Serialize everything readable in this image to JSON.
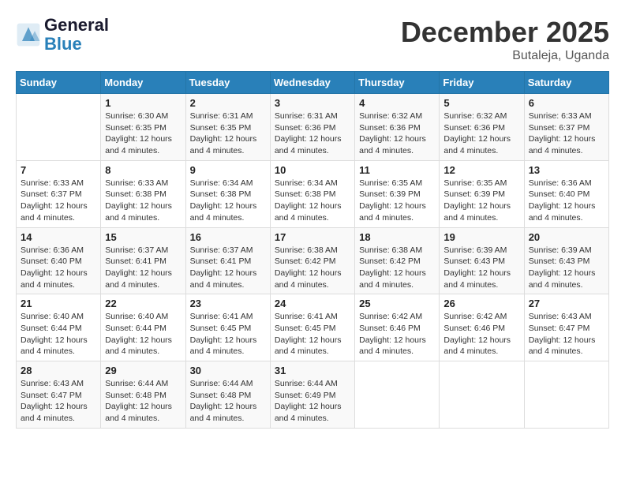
{
  "logo": {
    "line1": "General",
    "line2": "Blue"
  },
  "title": "December 2025",
  "location": "Butaleja, Uganda",
  "days_of_week": [
    "Sunday",
    "Monday",
    "Tuesday",
    "Wednesday",
    "Thursday",
    "Friday",
    "Saturday"
  ],
  "weeks": [
    [
      {
        "num": "",
        "sunrise": "",
        "sunset": "",
        "daylight": ""
      },
      {
        "num": "1",
        "sunrise": "Sunrise: 6:30 AM",
        "sunset": "Sunset: 6:35 PM",
        "daylight": "Daylight: 12 hours and 4 minutes."
      },
      {
        "num": "2",
        "sunrise": "Sunrise: 6:31 AM",
        "sunset": "Sunset: 6:35 PM",
        "daylight": "Daylight: 12 hours and 4 minutes."
      },
      {
        "num": "3",
        "sunrise": "Sunrise: 6:31 AM",
        "sunset": "Sunset: 6:36 PM",
        "daylight": "Daylight: 12 hours and 4 minutes."
      },
      {
        "num": "4",
        "sunrise": "Sunrise: 6:32 AM",
        "sunset": "Sunset: 6:36 PM",
        "daylight": "Daylight: 12 hours and 4 minutes."
      },
      {
        "num": "5",
        "sunrise": "Sunrise: 6:32 AM",
        "sunset": "Sunset: 6:36 PM",
        "daylight": "Daylight: 12 hours and 4 minutes."
      },
      {
        "num": "6",
        "sunrise": "Sunrise: 6:33 AM",
        "sunset": "Sunset: 6:37 PM",
        "daylight": "Daylight: 12 hours and 4 minutes."
      }
    ],
    [
      {
        "num": "7",
        "sunrise": "Sunrise: 6:33 AM",
        "sunset": "Sunset: 6:37 PM",
        "daylight": "Daylight: 12 hours and 4 minutes."
      },
      {
        "num": "8",
        "sunrise": "Sunrise: 6:33 AM",
        "sunset": "Sunset: 6:38 PM",
        "daylight": "Daylight: 12 hours and 4 minutes."
      },
      {
        "num": "9",
        "sunrise": "Sunrise: 6:34 AM",
        "sunset": "Sunset: 6:38 PM",
        "daylight": "Daylight: 12 hours and 4 minutes."
      },
      {
        "num": "10",
        "sunrise": "Sunrise: 6:34 AM",
        "sunset": "Sunset: 6:38 PM",
        "daylight": "Daylight: 12 hours and 4 minutes."
      },
      {
        "num": "11",
        "sunrise": "Sunrise: 6:35 AM",
        "sunset": "Sunset: 6:39 PM",
        "daylight": "Daylight: 12 hours and 4 minutes."
      },
      {
        "num": "12",
        "sunrise": "Sunrise: 6:35 AM",
        "sunset": "Sunset: 6:39 PM",
        "daylight": "Daylight: 12 hours and 4 minutes."
      },
      {
        "num": "13",
        "sunrise": "Sunrise: 6:36 AM",
        "sunset": "Sunset: 6:40 PM",
        "daylight": "Daylight: 12 hours and 4 minutes."
      }
    ],
    [
      {
        "num": "14",
        "sunrise": "Sunrise: 6:36 AM",
        "sunset": "Sunset: 6:40 PM",
        "daylight": "Daylight: 12 hours and 4 minutes."
      },
      {
        "num": "15",
        "sunrise": "Sunrise: 6:37 AM",
        "sunset": "Sunset: 6:41 PM",
        "daylight": "Daylight: 12 hours and 4 minutes."
      },
      {
        "num": "16",
        "sunrise": "Sunrise: 6:37 AM",
        "sunset": "Sunset: 6:41 PM",
        "daylight": "Daylight: 12 hours and 4 minutes."
      },
      {
        "num": "17",
        "sunrise": "Sunrise: 6:38 AM",
        "sunset": "Sunset: 6:42 PM",
        "daylight": "Daylight: 12 hours and 4 minutes."
      },
      {
        "num": "18",
        "sunrise": "Sunrise: 6:38 AM",
        "sunset": "Sunset: 6:42 PM",
        "daylight": "Daylight: 12 hours and 4 minutes."
      },
      {
        "num": "19",
        "sunrise": "Sunrise: 6:39 AM",
        "sunset": "Sunset: 6:43 PM",
        "daylight": "Daylight: 12 hours and 4 minutes."
      },
      {
        "num": "20",
        "sunrise": "Sunrise: 6:39 AM",
        "sunset": "Sunset: 6:43 PM",
        "daylight": "Daylight: 12 hours and 4 minutes."
      }
    ],
    [
      {
        "num": "21",
        "sunrise": "Sunrise: 6:40 AM",
        "sunset": "Sunset: 6:44 PM",
        "daylight": "Daylight: 12 hours and 4 minutes."
      },
      {
        "num": "22",
        "sunrise": "Sunrise: 6:40 AM",
        "sunset": "Sunset: 6:44 PM",
        "daylight": "Daylight: 12 hours and 4 minutes."
      },
      {
        "num": "23",
        "sunrise": "Sunrise: 6:41 AM",
        "sunset": "Sunset: 6:45 PM",
        "daylight": "Daylight: 12 hours and 4 minutes."
      },
      {
        "num": "24",
        "sunrise": "Sunrise: 6:41 AM",
        "sunset": "Sunset: 6:45 PM",
        "daylight": "Daylight: 12 hours and 4 minutes."
      },
      {
        "num": "25",
        "sunrise": "Sunrise: 6:42 AM",
        "sunset": "Sunset: 6:46 PM",
        "daylight": "Daylight: 12 hours and 4 minutes."
      },
      {
        "num": "26",
        "sunrise": "Sunrise: 6:42 AM",
        "sunset": "Sunset: 6:46 PM",
        "daylight": "Daylight: 12 hours and 4 minutes."
      },
      {
        "num": "27",
        "sunrise": "Sunrise: 6:43 AM",
        "sunset": "Sunset: 6:47 PM",
        "daylight": "Daylight: 12 hours and 4 minutes."
      }
    ],
    [
      {
        "num": "28",
        "sunrise": "Sunrise: 6:43 AM",
        "sunset": "Sunset: 6:47 PM",
        "daylight": "Daylight: 12 hours and 4 minutes."
      },
      {
        "num": "29",
        "sunrise": "Sunrise: 6:44 AM",
        "sunset": "Sunset: 6:48 PM",
        "daylight": "Daylight: 12 hours and 4 minutes."
      },
      {
        "num": "30",
        "sunrise": "Sunrise: 6:44 AM",
        "sunset": "Sunset: 6:48 PM",
        "daylight": "Daylight: 12 hours and 4 minutes."
      },
      {
        "num": "31",
        "sunrise": "Sunrise: 6:44 AM",
        "sunset": "Sunset: 6:49 PM",
        "daylight": "Daylight: 12 hours and 4 minutes."
      },
      {
        "num": "",
        "sunrise": "",
        "sunset": "",
        "daylight": ""
      },
      {
        "num": "",
        "sunrise": "",
        "sunset": "",
        "daylight": ""
      },
      {
        "num": "",
        "sunrise": "",
        "sunset": "",
        "daylight": ""
      }
    ]
  ]
}
